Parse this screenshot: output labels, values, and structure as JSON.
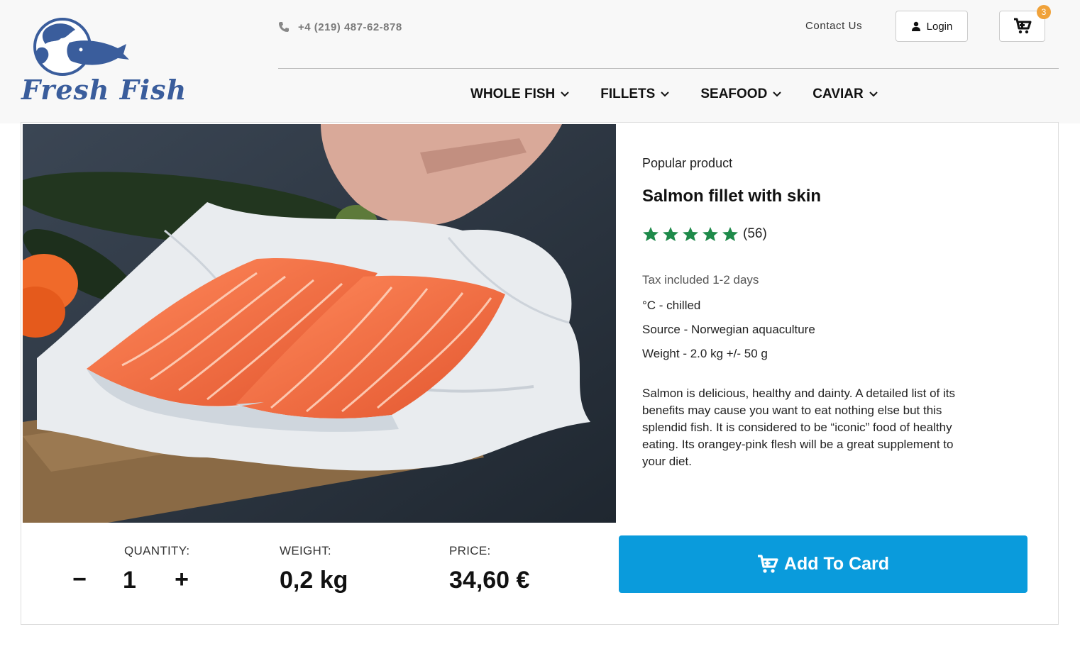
{
  "brand": {
    "name": "FreshFish",
    "color": "#3a5d9c"
  },
  "header": {
    "phone": "+4 (219) 487-62-878",
    "contact_label": "Contact Us",
    "login_label": "Login",
    "cart_count": "3",
    "icons": [
      "phone-icon",
      "user-icon",
      "cart-icon"
    ]
  },
  "nav": {
    "items": [
      {
        "label": "WHOLE FISH"
      },
      {
        "label": "FILLETS"
      },
      {
        "label": "SEAFOOD"
      },
      {
        "label": "CAVIAR"
      }
    ]
  },
  "product": {
    "tag": "Popular product",
    "title": "Salmon fillet with skin",
    "rating_stars": 5,
    "rating_count": "(56)",
    "star_color": "#1e8a4a",
    "tax_note": "Tax included 1-2 days",
    "specs": [
      "°C - chilled",
      "Source - Norwegian aquaculture",
      "Weight - 2.0 kg +/- 50 g"
    ],
    "description": "Salmon is delicious, healthy and dainty. A detailed list of its benefits may cause you want to eat nothing else but this splendid fish. It is considered to be “iconic” food of healthy eating. Its orangey-pink flesh will be a great supplement to your diet."
  },
  "purchase": {
    "quantity_label": "QUANTITY:",
    "quantity_value": "1",
    "minus_label": "−",
    "plus_label": "+",
    "weight_label": "WEIGHT:",
    "weight_value": "0,2 kg",
    "price_label": "PRICE:",
    "price_value": "34,60 €",
    "add_button_label": "Add To Card",
    "button_color": "#0a9bdc"
  }
}
